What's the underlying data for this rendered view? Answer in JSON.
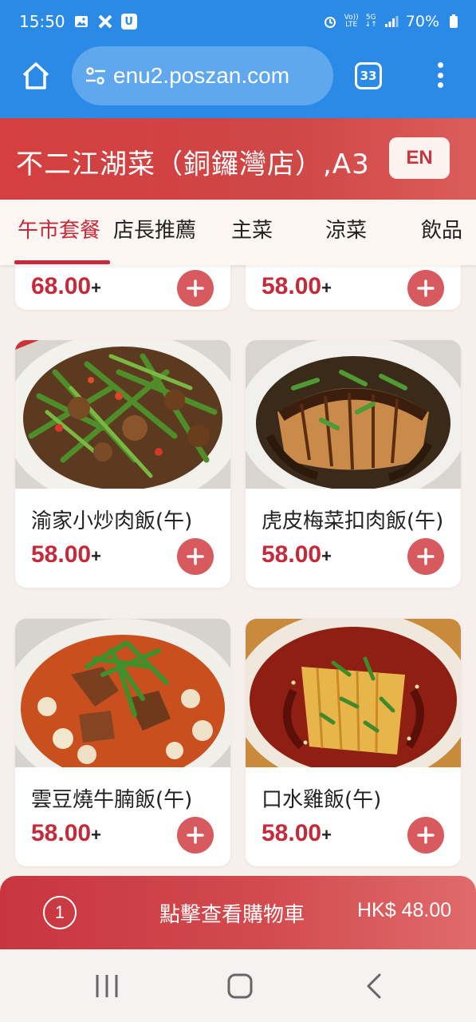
{
  "status_bar": {
    "time": "15:50",
    "battery": "70%",
    "left_icons": [
      "gallery-icon",
      "x-app-icon",
      "app-badge-icon"
    ],
    "right_icons": [
      "alarm-icon",
      "volte-icon",
      "5g-icon",
      "signal-icon",
      "battery-icon"
    ],
    "volte_top": "Vo))",
    "volte_bottom": "LTE",
    "net_top": "5G",
    "net_bottom": "↓↑"
  },
  "browser": {
    "url": "enu2.poszan.com",
    "tab_count": "33"
  },
  "restaurant": {
    "name": "不二江湖菜（銅鑼灣店）,A3",
    "language_button": "EN"
  },
  "categories": [
    {
      "label": "午市套餐",
      "active": true
    },
    {
      "label": "店長推薦",
      "active": false
    },
    {
      "label": "主菜",
      "active": false
    },
    {
      "label": "涼菜",
      "active": false
    },
    {
      "label": "飲品",
      "active": false
    }
  ],
  "menu": {
    "partial_top": [
      {
        "price": "68.00",
        "suffix": "+"
      },
      {
        "price": "58.00",
        "suffix": "+"
      }
    ],
    "items": [
      {
        "name": "渝家小炒肉飯(午)",
        "price": "58.00",
        "suffix": "+"
      },
      {
        "name": "虎皮梅菜扣肉飯(午)",
        "price": "58.00",
        "suffix": "+"
      },
      {
        "name": "雲豆燒牛腩飯(午)",
        "price": "58.00",
        "suffix": "+"
      },
      {
        "name": "口水雞飯(午)",
        "price": "58.00",
        "suffix": "+"
      }
    ]
  },
  "cart": {
    "count": "1",
    "label": "點擊查看購物車",
    "total": "HK$ 48.00"
  },
  "nav_bar": {
    "buttons": [
      "recent-apps-icon",
      "home-icon",
      "back-icon"
    ]
  },
  "colors": {
    "browser_blue": "#2a8ae6",
    "brand_red": "#c42b3a",
    "add_button": "#d75a5f"
  }
}
